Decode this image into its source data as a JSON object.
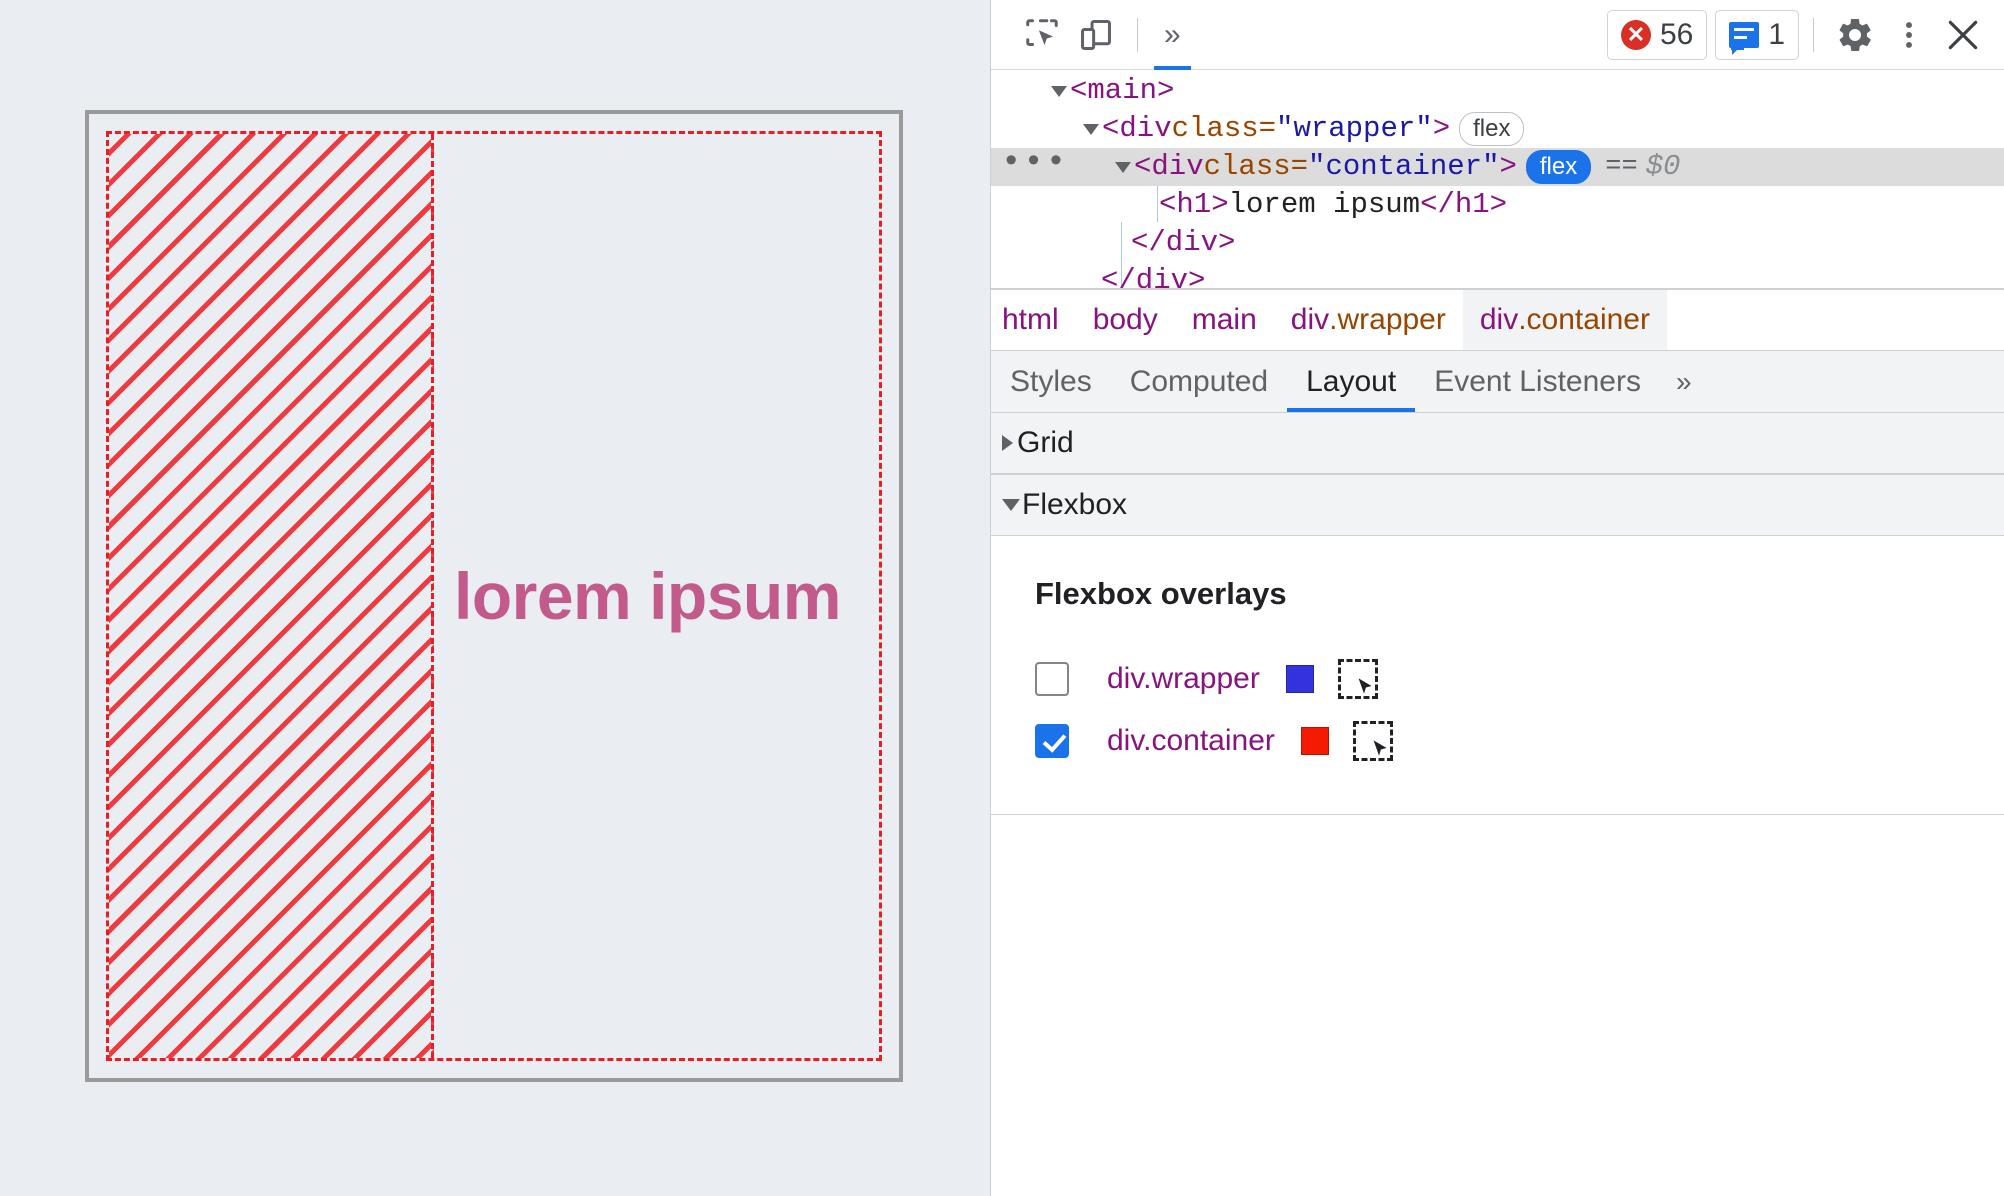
{
  "viewport": {
    "heading": "lorem ipsum",
    "heading_color": "#c25b8c",
    "overlay_color": "#ec1c24",
    "background": "#eaedf1",
    "border_color": "#9a9a9a"
  },
  "toolbar": {
    "inspect_icon": "inspect-cursor-icon",
    "device_icon": "device-toolbar-icon",
    "more_panels_icon": "chevron-double-right-icon",
    "errors": {
      "icon": "error-circle-icon",
      "count": "56"
    },
    "messages": {
      "icon": "message-icon",
      "count": "1"
    },
    "settings_icon": "gear-icon",
    "menu_icon": "three-dot-menu-icon",
    "close_icon": "close-icon"
  },
  "dom_tree": {
    "rows": [
      {
        "indent": 60,
        "triangle": "open",
        "parts": [
          {
            "t": "tag",
            "v": "<main>"
          }
        ]
      },
      {
        "indent": 92,
        "triangle": "open",
        "parts": [
          {
            "t": "tag",
            "v": "<div "
          },
          {
            "t": "attr",
            "v": "class="
          },
          {
            "t": "attrval",
            "v": "\"wrapper\""
          },
          {
            "t": "tag",
            "v": ">"
          }
        ],
        "badge": "flex",
        "badge_active": false
      },
      {
        "indent": 124,
        "triangle": "open",
        "selected": true,
        "dots": "⋯",
        "parts": [
          {
            "t": "tag",
            "v": "<div "
          },
          {
            "t": "attr",
            "v": "class="
          },
          {
            "t": "attrval",
            "v": "\"container\""
          },
          {
            "t": "tag",
            "v": ">"
          }
        ],
        "badge": "flex",
        "badge_active": true,
        "eqeq": "==",
        "dollar": "$0"
      },
      {
        "indent": 168,
        "parts": [
          {
            "t": "tag",
            "v": "<h1>"
          },
          {
            "t": "txt",
            "v": "lorem ipsum"
          },
          {
            "t": "tag",
            "v": "</h1>"
          }
        ]
      },
      {
        "indent": 140,
        "parts": [
          {
            "t": "tag",
            "v": "</div>"
          }
        ]
      },
      {
        "indent": 110,
        "parts": [
          {
            "t": "tag",
            "v": "</div>"
          }
        ]
      }
    ]
  },
  "breadcrumb": {
    "items": [
      {
        "tag": "html",
        "cls": "",
        "selected": false
      },
      {
        "tag": "body",
        "cls": "",
        "selected": false
      },
      {
        "tag": "main",
        "cls": "",
        "selected": false
      },
      {
        "tag": "div",
        "cls": ".wrapper",
        "selected": false
      },
      {
        "tag": "div",
        "cls": ".container",
        "selected": true
      }
    ]
  },
  "subtabs": {
    "items": [
      {
        "label": "Styles",
        "active": false
      },
      {
        "label": "Computed",
        "active": false
      },
      {
        "label": "Layout",
        "active": true
      },
      {
        "label": "Event Listeners",
        "active": false
      }
    ],
    "more": "»"
  },
  "panes": {
    "grid": {
      "title": "Grid",
      "expanded": false
    },
    "flexbox": {
      "title": "Flexbox",
      "expanded": true,
      "section_title": "Flexbox overlays",
      "overlays": [
        {
          "label": "div.wrapper",
          "checked": false,
          "color": "#3333dd",
          "picker_icon": "element-picker-icon"
        },
        {
          "label": "div.container",
          "checked": true,
          "color": "#f51b00",
          "picker_icon": "element-picker-icon"
        }
      ]
    }
  }
}
